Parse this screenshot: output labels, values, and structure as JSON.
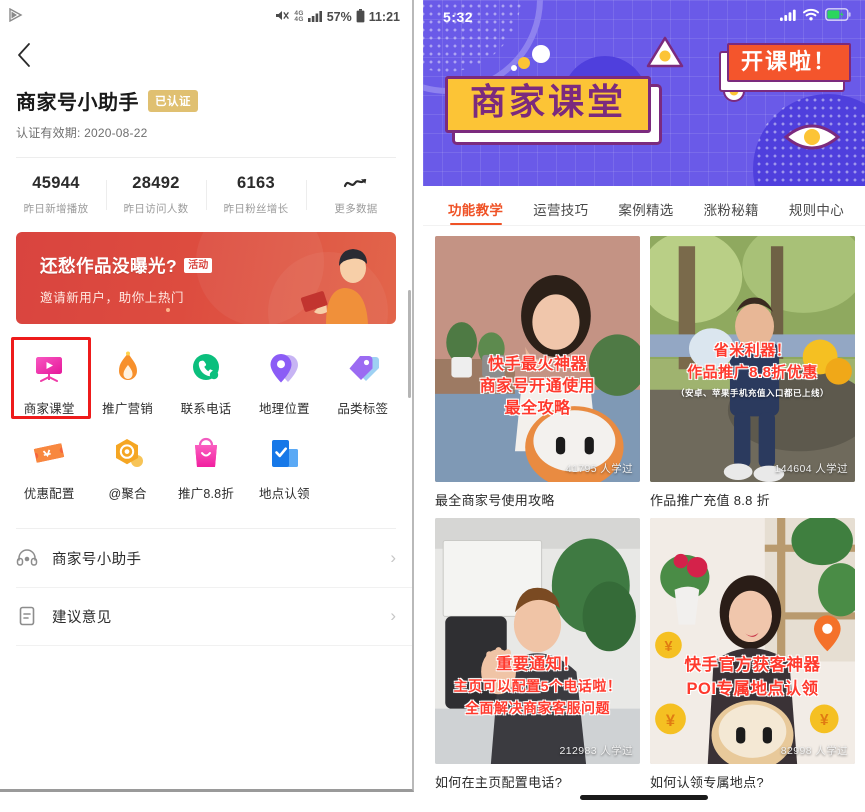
{
  "left": {
    "status_bar": {
      "mute_icon": "mute-icon",
      "network_label_top": "4G",
      "network_label_bottom": "4G",
      "signal_icon": "signal-bars-icon",
      "battery_pct": "57%",
      "battery_icon": "battery-icon",
      "time": "11:21",
      "app_icon": "play-triangle-icon"
    },
    "back_icon": "back-chevron-icon",
    "header": {
      "title": "商家号小助手",
      "badge": "已认证",
      "subtitle": "认证有效期: 2020-08-22"
    },
    "stats": [
      {
        "value": "45944",
        "label": "昨日新增播放"
      },
      {
        "value": "28492",
        "label": "昨日访问人数"
      },
      {
        "value": "6163",
        "label": "昨日粉丝增长"
      },
      {
        "value": "",
        "label": "更多数据",
        "icon": "trend-line-icon"
      }
    ],
    "promo": {
      "headline": "还愁作品没曝光?",
      "tag": "活动",
      "sub": "邀请新用户，助你上热门"
    },
    "grid": [
      {
        "label": "商家课堂",
        "icon": "projector-screen-icon",
        "highlighted": true
      },
      {
        "label": "推广营销",
        "icon": "flame-icon",
        "highlighted": false
      },
      {
        "label": "联系电话",
        "icon": "phone-icon",
        "highlighted": false
      },
      {
        "label": "地理位置",
        "icon": "map-pin-icon",
        "highlighted": false
      },
      {
        "label": "品类标签",
        "icon": "tag-icon",
        "highlighted": false
      },
      {
        "label": "优惠配置",
        "icon": "coupon-ticket-icon",
        "highlighted": false
      },
      {
        "label": "@聚合",
        "icon": "at-hexagon-icon",
        "highlighted": false
      },
      {
        "label": "推广8.8折",
        "icon": "shopping-bag-icon",
        "highlighted": false
      },
      {
        "label": "地点认领",
        "icon": "check-building-icon",
        "highlighted": false
      }
    ],
    "list": [
      {
        "label": "商家号小助手",
        "icon": "headset-icon",
        "arrow": "›"
      },
      {
        "label": "建议意见",
        "icon": "feedback-doc-icon",
        "arrow": "›"
      }
    ]
  },
  "right": {
    "status_bar": {
      "time": "5:32",
      "signal_icon": "signal-bars-icon",
      "wifi_icon": "wifi-icon",
      "battery_icon": "battery-charging-icon"
    },
    "banner": {
      "title": "商家课堂",
      "cta": "开课啦！"
    },
    "tabs": [
      {
        "label": "功能教学",
        "active": true
      },
      {
        "label": "运营技巧",
        "active": false
      },
      {
        "label": "案例精选",
        "active": false
      },
      {
        "label": "涨粉秘籍",
        "active": false
      },
      {
        "label": "规则中心",
        "active": false
      }
    ],
    "cards": [
      {
        "title": "最全商家号使用攻略",
        "views": "41795 人学过",
        "overlay_lines": [
          "快手最火神器",
          "商家号开通使用",
          "最全攻略"
        ]
      },
      {
        "title": "作品推广充值 8.8 折",
        "views": "144604 人学过",
        "overlay_lines": [
          "省米利器！",
          "作品推广8.8折优惠",
          "（安卓、苹果手机充值入口都已上线）"
        ]
      },
      {
        "title": "如何在主页配置电话?",
        "views": "212983 人学过",
        "overlay_lines": [
          "重要通知！",
          "主页可以配置5个电话啦！",
          "全面解决商家客服问题"
        ]
      },
      {
        "title": "如何认领专属地点?",
        "views": "82998 人学过",
        "overlay_lines": [
          "快手官方获客神器",
          "POI专属地点认领"
        ]
      }
    ]
  },
  "colors": {
    "accent_orange": "#ef5226",
    "banner_purple": "#6a5ae8",
    "banner_yellow": "#fcc436",
    "banner_magenta": "#7b2a7e",
    "promo_red": "#d9443f",
    "badge_gold": "#e0c071",
    "highlight_red": "#ee1b1b"
  }
}
